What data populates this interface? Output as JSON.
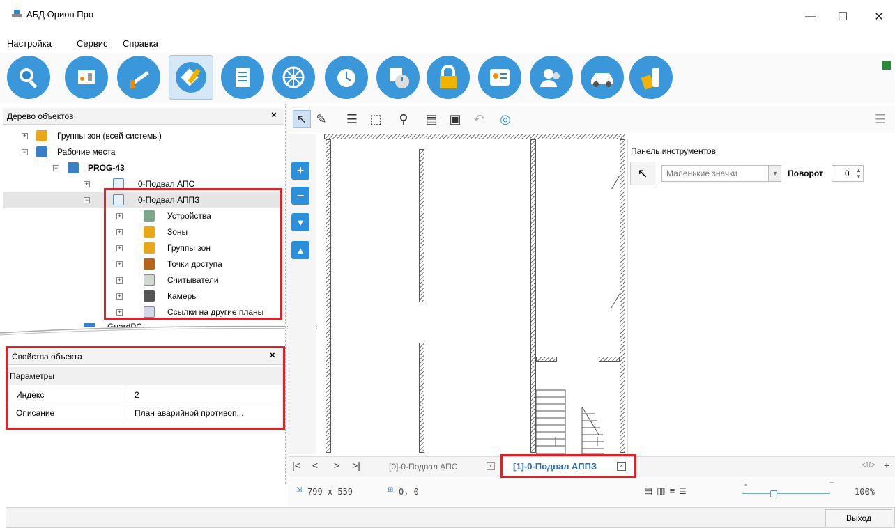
{
  "window": {
    "title": "АБД Орион Про",
    "minimize": "—",
    "maximize": "☐",
    "close": "✕"
  },
  "menu": [
    "Настройка",
    "Сервис",
    "Справка"
  ],
  "toolbar_icons": [
    "search-icon",
    "device-icon",
    "barrier-icon",
    "plan-edit-icon",
    "list-icon",
    "wheel-icon",
    "alarm-clock-icon",
    "schedule-icon",
    "lock-icon",
    "badge-icon",
    "users-icon",
    "car-icon",
    "key-icon"
  ],
  "tree": {
    "header": "Дерево объектов",
    "close": "×",
    "rows": [
      {
        "label": "Группы зон (всей системы)"
      },
      {
        "label": "Рабочие места"
      },
      {
        "label": "PROG-43"
      },
      {
        "label": "0-Подвал АПС"
      },
      {
        "label": "0-Подвал АППЗ"
      },
      {
        "label": "Устройства"
      },
      {
        "label": "Зоны"
      },
      {
        "label": "Группы зон"
      },
      {
        "label": "Точки доступа"
      },
      {
        "label": "Считыватели"
      },
      {
        "label": "Камеры"
      },
      {
        "label": "Ссылки на другие планы"
      },
      {
        "label": "GuardPC"
      }
    ]
  },
  "properties": {
    "header": "Свойства объекта",
    "close": "×",
    "section": "Параметры",
    "rows": [
      {
        "key": "Индекс",
        "value": "2"
      },
      {
        "key": "Описание",
        "value": "План аварийной противоп..."
      }
    ]
  },
  "tools_panel": {
    "title": "Панель инструментов",
    "view_value": "Маленькие значки",
    "rotation_label": "Поворот",
    "rotation_value": "0"
  },
  "tabs": [
    {
      "label": "[0]-0-Подвал АПС",
      "active": false
    },
    {
      "label": "[1]-0-Подвал АППЗ",
      "active": true
    }
  ],
  "status": {
    "size": "799 x 559",
    "coords": "0, 0",
    "zoom": "100%",
    "minus": "-",
    "plus": "+"
  },
  "bottom": {
    "exit_label": "Выход"
  },
  "colors": {
    "accent": "#2f86c8",
    "highlight": "#d8232a"
  }
}
